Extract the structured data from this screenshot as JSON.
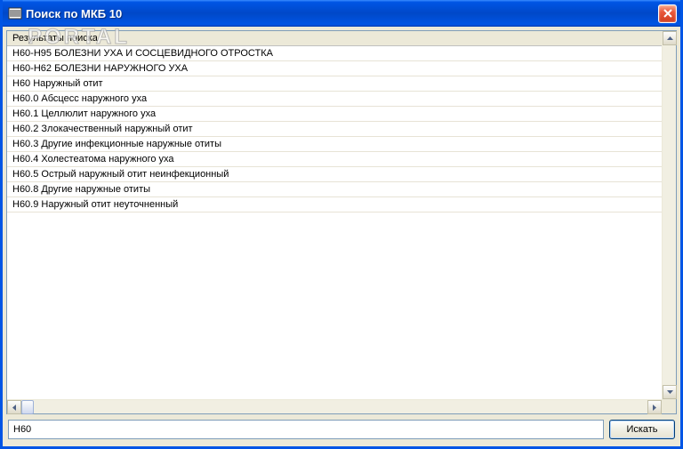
{
  "window": {
    "title": "Поиск по МКБ 10"
  },
  "watermark": "PORTAL",
  "results": {
    "header": "Результаты поиска",
    "items": [
      "H60-H95 БОЛЕЗНИ УХА И СОСЦЕВИДНОГО ОТРОСТКА",
      "H60-H62 БОЛЕЗНИ НАРУЖНОГО УХА",
      "H60 Наружный отит",
      "H60.0 Абсцесс наружного уха",
      "H60.1 Целлюлит наружного уха",
      "H60.2 Злокачественный наружный отит",
      "H60.3 Другие инфекционные наружные отиты",
      "H60.4 Холестеатома наружного уха",
      "H60.5 Острый наружный отит неинфекционный",
      "H60.8 Другие наружные отиты",
      "H60.9 Наружный отит неуточненный"
    ]
  },
  "search": {
    "value": "H60",
    "button": "Искать"
  }
}
